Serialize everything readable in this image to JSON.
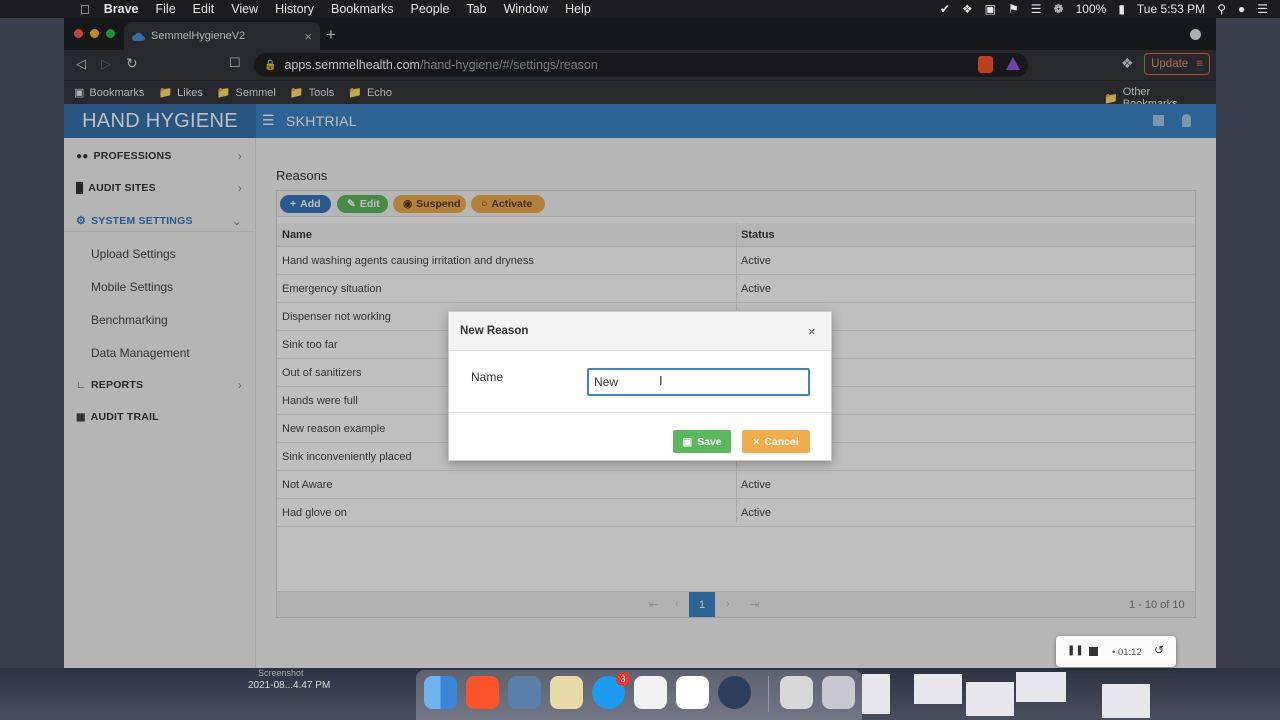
{
  "menubar": {
    "app": "Brave",
    "items": [
      "File",
      "Edit",
      "View",
      "History",
      "Bookmarks",
      "People",
      "Tab",
      "Window",
      "Help"
    ],
    "battery": "100%",
    "clock": "Tue 5:53 PM"
  },
  "browser": {
    "tab_title": "SemmelHygieneV2",
    "url_host": "apps.semmelhealth.com",
    "url_path": "/hand-hygiene/#/settings/reason",
    "update_label": "Update",
    "bookmarks": [
      "Bookmarks",
      "Likes",
      "Semmel",
      "Tools",
      "Echo"
    ],
    "other_bookmarks": "Other Bookmarks"
  },
  "app": {
    "brand": "HAND HYGIENE",
    "org": "SKHTRIAL"
  },
  "sidebar": {
    "professions": "PROFESSIONS",
    "audit_sites": "AUDIT SITES",
    "system_settings": "SYSTEM SETTINGS",
    "sub": [
      "Upload Settings",
      "Mobile Settings",
      "Benchmarking",
      "Data Management"
    ],
    "reports": "REPORTS",
    "audit_trail": "AUDIT TRAIL"
  },
  "page": {
    "title": "Reasons",
    "buttons": {
      "add": "Add",
      "edit": "Edit",
      "suspend": "Suspend",
      "activate": "Activate"
    },
    "columns": {
      "name": "Name",
      "status": "Status"
    },
    "rows": [
      {
        "name": "Hand washing agents causing irritation and dryness",
        "status": "Active"
      },
      {
        "name": "Emergency situation",
        "status": "Active"
      },
      {
        "name": "Dispenser not working",
        "status": ""
      },
      {
        "name": "Sink too far",
        "status": ""
      },
      {
        "name": "Out of sanitizers",
        "status": ""
      },
      {
        "name": "Hands were full",
        "status": ""
      },
      {
        "name": "New reason example",
        "status": ""
      },
      {
        "name": "Sink inconveniently placed",
        "status": ""
      },
      {
        "name": "Not Aware",
        "status": "Active"
      },
      {
        "name": "Had glove on",
        "status": "Active"
      }
    ],
    "pager": {
      "current": "1",
      "summary": "1 - 10 of 10"
    }
  },
  "modal": {
    "title": "New Reason",
    "close": "×",
    "label": "Name",
    "value": "New",
    "save": "Save",
    "cancel": "Cancel"
  },
  "recorder": {
    "time": "• 01:12"
  },
  "desktop": {
    "caption_line1": "Screenshot",
    "caption_line2": "2021-08...4.47 PM",
    "badge": "3"
  }
}
